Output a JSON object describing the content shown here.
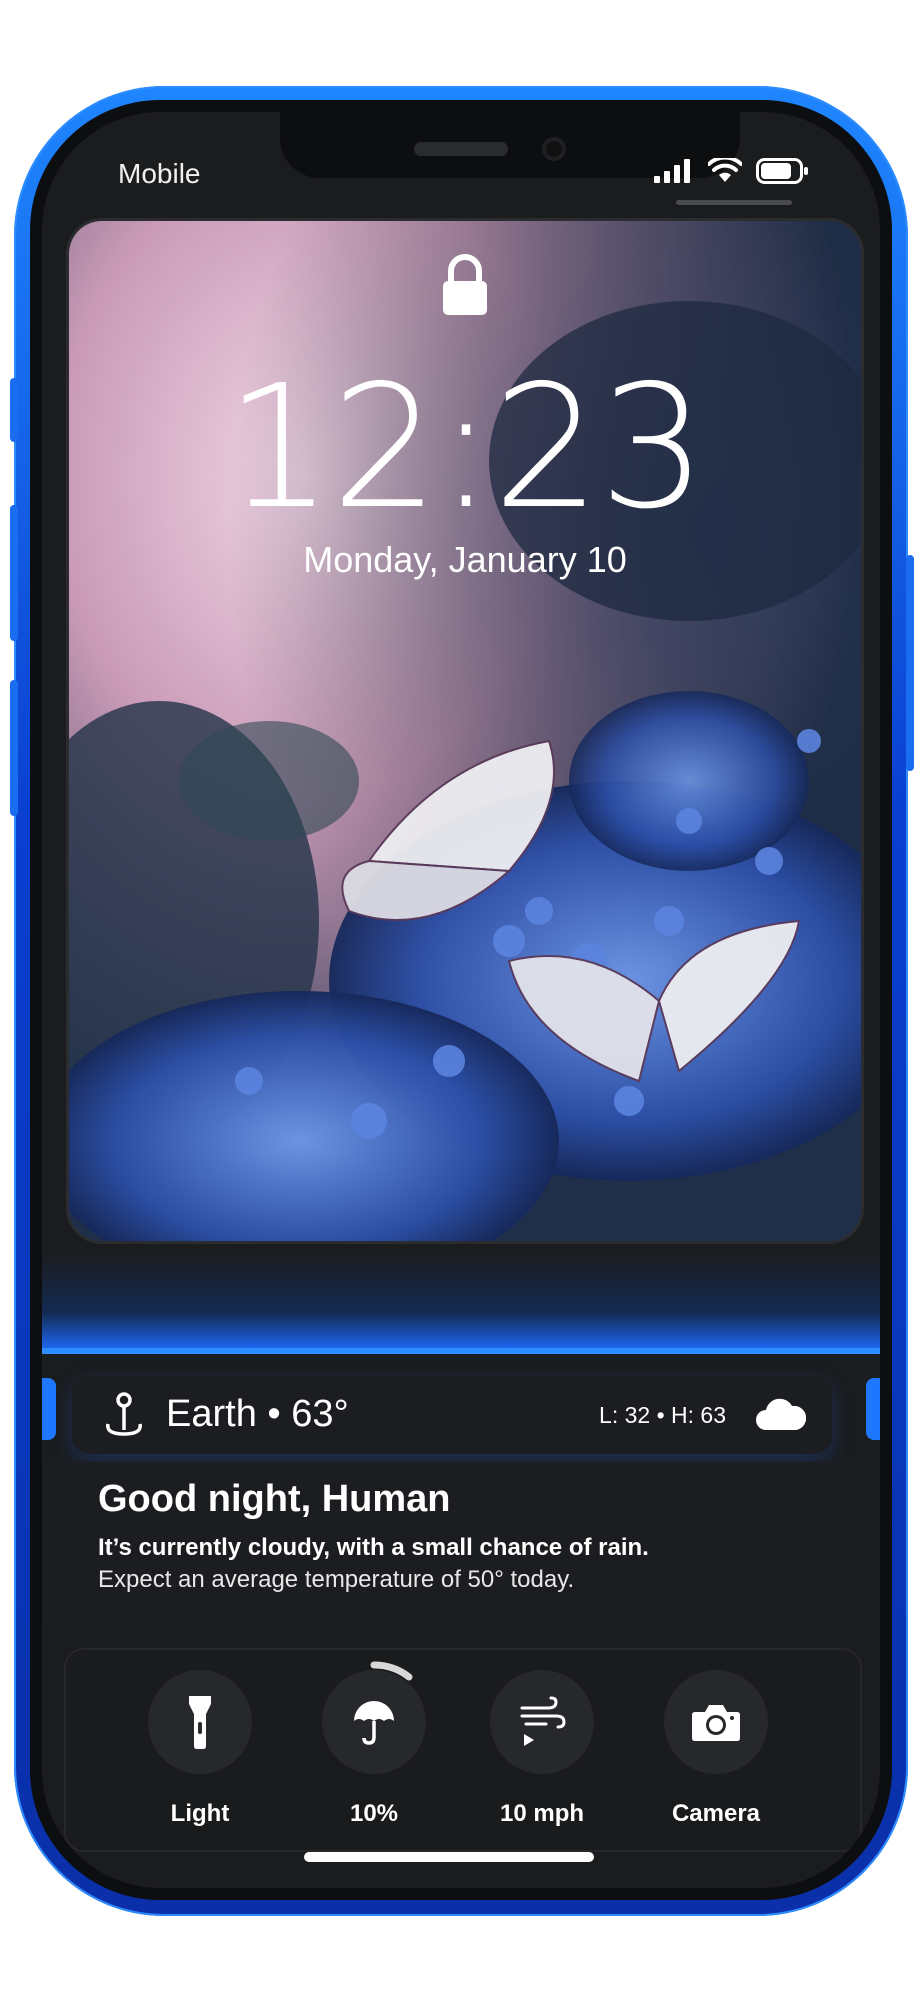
{
  "status_bar": {
    "carrier": "Mobile",
    "icons": [
      "signal-icon",
      "wifi-icon",
      "battery-icon"
    ]
  },
  "lock_screen": {
    "lock_icon": "lock-icon",
    "time": "12:23",
    "date": "Monday, January 10"
  },
  "weather": {
    "location": "Earth • 63°",
    "hi_lo": "L: 32 • H: 63",
    "icon": "cloud-icon"
  },
  "greeting": {
    "title": "Good night, Human",
    "line1": "It’s currently cloudy, with a small chance of rain.",
    "line2": "Expect an average temperature of 50° today."
  },
  "quick_actions": [
    {
      "label": "Light",
      "icon": "flashlight-icon"
    },
    {
      "label": "10%",
      "icon": "umbrella-icon"
    },
    {
      "label": "10 mph",
      "icon": "wind-icon"
    },
    {
      "label": "Camera",
      "icon": "camera-icon"
    }
  ],
  "colors": {
    "accent": "#1e78ff",
    "background": "#1b1c1e",
    "text": "#ffffff"
  }
}
